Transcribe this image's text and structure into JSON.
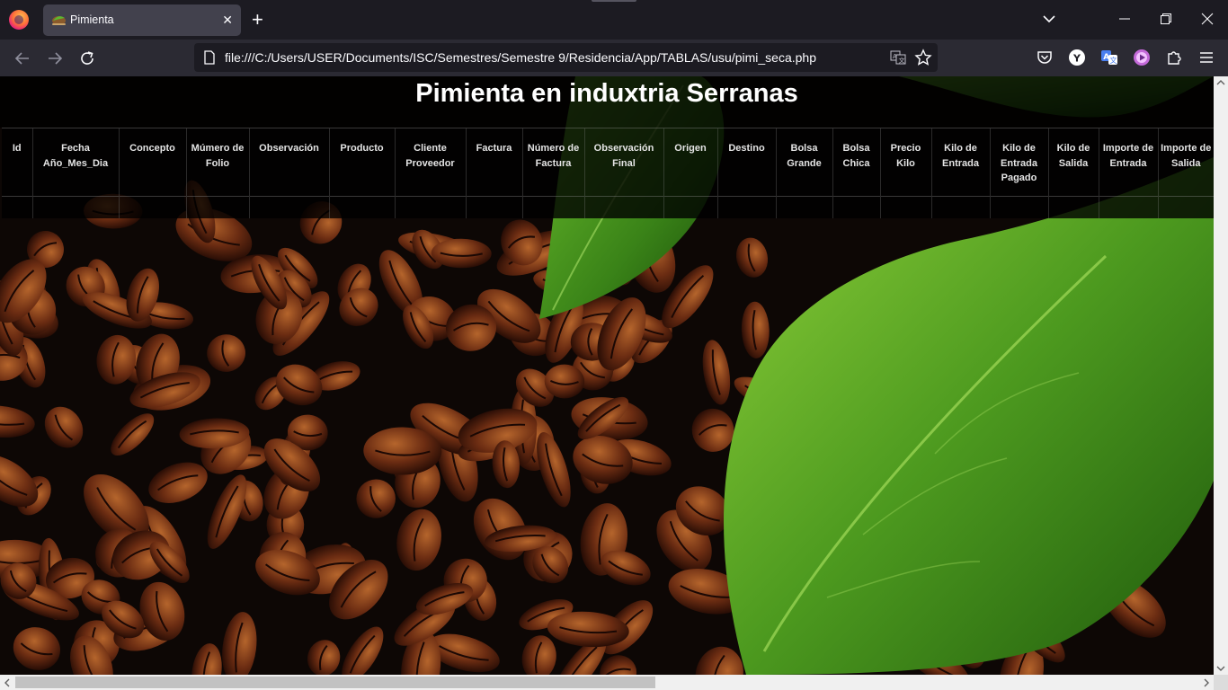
{
  "browser": {
    "tab": {
      "title": "Pimienta"
    },
    "url": "file:///C:/Users/USER/Documents/ISC/Semestres/Semestre 9/Residencia/App/TABLAS/usu/pimi_seca.php"
  },
  "page": {
    "title": "Pimienta en induxtria Serranas",
    "table": {
      "columns": [
        "Id",
        "Fecha Año_Mes_Dia",
        "Concepto",
        "Múmero de Folio",
        "Observación",
        "Producto",
        "Cliente Proveedor",
        "Factura",
        "Número de Factura",
        "Observación Final",
        "Origen",
        "Destino",
        "Bolsa Grande",
        "Bolsa Chica",
        "Precio Kilo",
        "Kilo de Entrada",
        "Kilo de Entrada Pagado",
        "Kilo de Salida",
        "Importe de Entrada",
        "Importe de Salida"
      ],
      "rows": [
        [
          "",
          "",
          "",
          "",
          "",
          "",
          "",
          "",
          "",
          "",
          "",
          "",
          "",
          "",
          "",
          "",
          "",
          "",
          "",
          ""
        ]
      ]
    }
  },
  "colors": {
    "chrome_dark": "#1c1b22",
    "chrome_nav": "#2b2a33",
    "tab_active": "#42414d",
    "leaf_green": "#4d9a1f",
    "coffee_brown": "#6b2c12"
  }
}
